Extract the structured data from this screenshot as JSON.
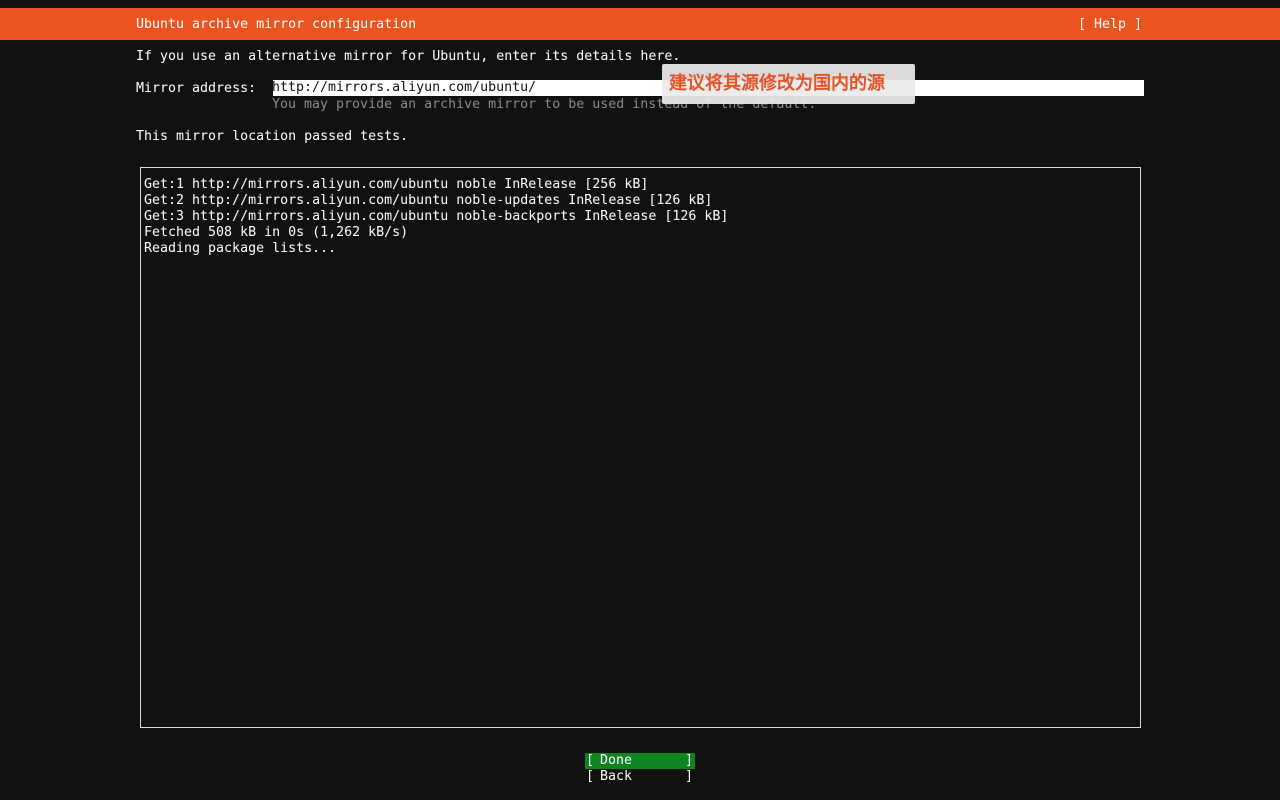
{
  "header": {
    "title": "Ubuntu archive mirror configuration",
    "help_label": "[ Help ]"
  },
  "intro": "If you use an alternative mirror for Ubuntu, enter its details here.",
  "mirror": {
    "label": "Mirror address:",
    "value": "http://mirrors.aliyun.com/ubuntu/",
    "help": "You may provide an archive mirror to be used instead of the default."
  },
  "status": "This mirror location passed tests.",
  "log": [
    "Get:1 http://mirrors.aliyun.com/ubuntu noble InRelease [256 kB]",
    "Get:2 http://mirrors.aliyun.com/ubuntu noble-updates InRelease [126 kB]",
    "Get:3 http://mirrors.aliyun.com/ubuntu noble-backports InRelease [126 kB]",
    "Fetched 508 kB in 0s (1,262 kB/s)",
    "Reading package lists..."
  ],
  "annotation": "建议将其源修改为国内的源",
  "buttons": {
    "bracket_left": "[",
    "bracket_right": "]",
    "done": "Done",
    "back": "Back"
  },
  "colors": {
    "header_bg": "#e95420",
    "background": "#111111",
    "done_bg": "#0e8420",
    "annotation_text": "#e4552a"
  }
}
